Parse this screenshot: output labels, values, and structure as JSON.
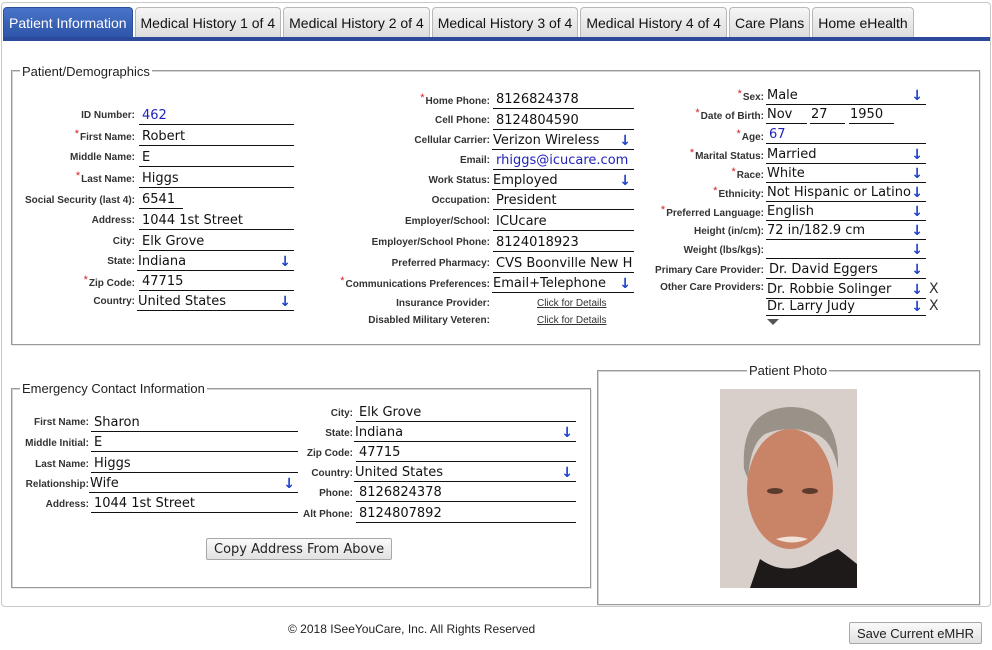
{
  "tabs": [
    {
      "label": "Patient Information",
      "active": true
    },
    {
      "label": "Medical History 1 of 4"
    },
    {
      "label": "Medical History 2 of 4"
    },
    {
      "label": "Medical History 3 of 4"
    },
    {
      "label": "Medical History 4 of 4"
    },
    {
      "label": "Care Plans"
    },
    {
      "label": "Home eHealth"
    }
  ],
  "demographics": {
    "legend": "Patient/Demographics",
    "col1": {
      "id_label": "ID Number:",
      "id": "462",
      "first_label": "First Name:",
      "first": "Robert",
      "middle_label": "Middle Name:",
      "middle": "E",
      "last_label": "Last Name:",
      "last": "Higgs",
      "ssn_label": "Social Security (last 4):",
      "ssn": "6541",
      "address_label": "Address:",
      "address": "1044 1st Street",
      "city_label": "City:",
      "city": "Elk Grove",
      "state_label": "State:",
      "state": "Indiana",
      "zip_label": "Zip Code:",
      "zip": "47715",
      "country_label": "Country:",
      "country": "United States"
    },
    "col2": {
      "home_phone_label": "Home Phone:",
      "home_phone": "8126824378",
      "cell_phone_label": "Cell Phone:",
      "cell_phone": "8124804590",
      "carrier_label": "Cellular Carrier:",
      "carrier": "Verizon Wireless",
      "email_label": "Email:",
      "email": "rhiggs@icucare.com",
      "work_status_label": "Work Status:",
      "work_status": "Employed",
      "occupation_label": "Occupation:",
      "occupation": "President",
      "employer_label": "Employer/School:",
      "employer": "ICUcare",
      "employer_phone_label": "Employer/School Phone:",
      "employer_phone": "8124018923",
      "pharmacy_label": "Preferred Pharmacy:",
      "pharmacy": "CVS Boonville New H",
      "comm_label": "Communications Preferences:",
      "comm": "Email+Telephone",
      "insurance_label": "Insurance Provider:",
      "insurance_link": "Click for Details",
      "veteran_label": "Disabled Military Veteren:",
      "veteran_link": "Click for Details"
    },
    "col3": {
      "sex_label": "Sex:",
      "sex": "Male",
      "dob_label": "Date of Birth:",
      "dob_month": "Nov",
      "dob_day": "27",
      "dob_year": "1950",
      "age_label": "Age:",
      "age": "67",
      "marital_label": "Marital Status:",
      "marital": "Married",
      "race_label": "Race:",
      "race": "White",
      "ethnicity_label": "Ethnicity:",
      "ethnicity": "Not Hispanic or Latino",
      "language_label": "Preferred Language:",
      "language": "English",
      "height_label": "Height (in/cm):",
      "height": "72 in/182.9 cm",
      "weight_label": "Weight (lbs/kgs):",
      "weight": "",
      "pcp_label": "Primary Care Provider:",
      "pcp": "Dr. David Eggers",
      "other_label": "Other Care Providers:",
      "other_providers": [
        "Dr. Robbie Solinger",
        "Dr. Larry Judy"
      ],
      "remove_glyph": "X"
    },
    "dropdown_glyph": "↓",
    "required_glyph": "*"
  },
  "emergency": {
    "legend": "Emergency Contact Information",
    "first_label": "First Name:",
    "first": "Sharon",
    "middle_label": "Middle Initial:",
    "middle": "E",
    "last_label": "Last Name:",
    "last": "Higgs",
    "relationship_label": "Relationship:",
    "relationship": "Wife",
    "address_label": "Address:",
    "address": "1044 1st Street",
    "city_label": "City:",
    "city": "Elk Grove",
    "state_label": "State:",
    "state": "Indiana",
    "zip_label": "Zip Code:",
    "zip": "47715",
    "country_label": "Country:",
    "country": "United States",
    "phone_label": "Phone:",
    "phone": "8126824378",
    "alt_phone_label": "Alt Phone:",
    "alt_phone": "8124807892",
    "copy_button": "Copy Address From Above"
  },
  "photo": {
    "legend": "Patient Photo"
  },
  "footer": {
    "copyright": "© 2018 ISeeYouCare, Inc. All Rights Reserved"
  },
  "save_button": "Save Current eMHR"
}
